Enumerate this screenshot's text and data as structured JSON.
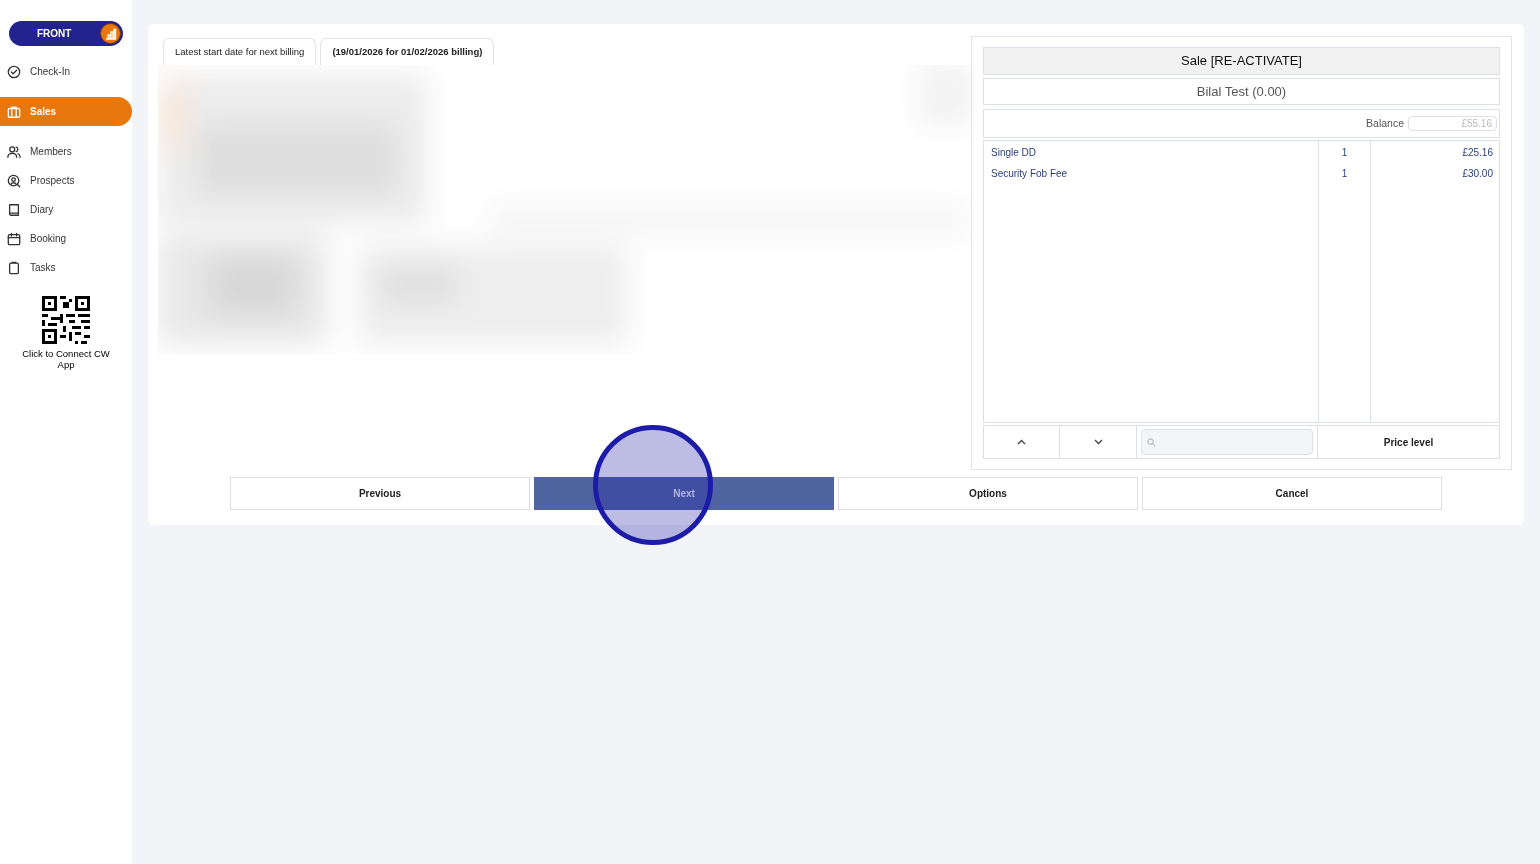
{
  "sidebar": {
    "mode_toggle": {
      "label": "FRONT"
    },
    "items": [
      {
        "label": "Check-In",
        "kind": "check",
        "selected": false
      },
      {
        "label": "Sales",
        "kind": "briefcase",
        "selected": true
      },
      {
        "label": "Members",
        "kind": "people",
        "selected": false
      },
      {
        "label": "Prospects",
        "kind": "person-search",
        "selected": false
      },
      {
        "label": "Diary",
        "kind": "book",
        "selected": false
      },
      {
        "label": "Booking",
        "kind": "calendar",
        "selected": false
      },
      {
        "label": "Tasks",
        "kind": "clipboard",
        "selected": false
      }
    ],
    "connect_app": {
      "label": "Click to Connect CW App"
    }
  },
  "billing_info": {
    "label": "Latest start date for next billing",
    "value": "(19/01/2026 for 01/02/2026 billing)"
  },
  "sale_panel": {
    "title": "Sale [RE-ACTIVATE]",
    "customer": "Bilal Test (0.00)",
    "balance_label": "Balance",
    "balance_value": "£55.16",
    "lines": [
      {
        "name": "Single DD",
        "quantity": "1",
        "price": "£25.16"
      },
      {
        "name": "Security Fob Fee",
        "quantity": "1",
        "price": "£30.00"
      }
    ],
    "price_level_button": "Price level"
  },
  "buttons": [
    {
      "label": "Previous",
      "kind": "default"
    },
    {
      "label": "Next",
      "kind": "primary"
    },
    {
      "label": "Options",
      "kind": "default"
    },
    {
      "label": "Cancel",
      "kind": "default"
    }
  ]
}
